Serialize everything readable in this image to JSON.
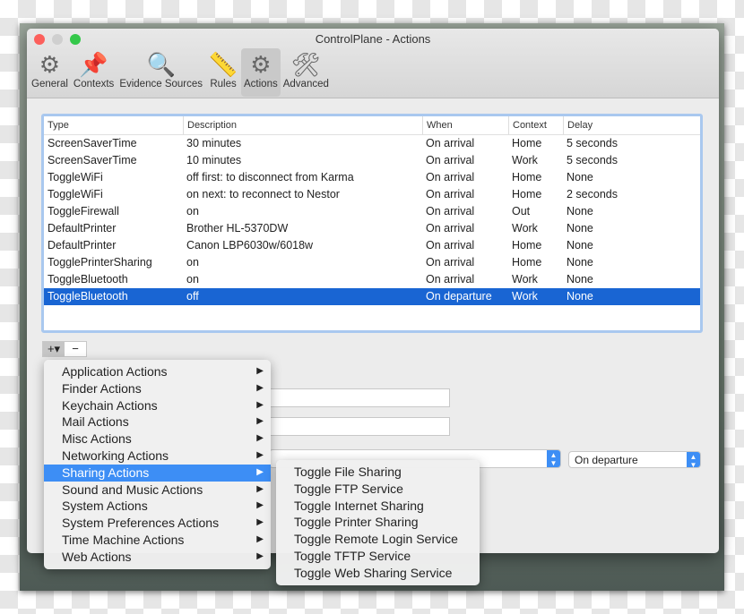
{
  "window": {
    "title": "ControlPlane - Actions"
  },
  "toolbar": [
    {
      "label": "General",
      "icon": "general-icon",
      "glyph": "⚙"
    },
    {
      "label": "Contexts",
      "icon": "pushpin-icon",
      "glyph": "📌"
    },
    {
      "label": "Evidence Sources",
      "icon": "magnifier-icon",
      "glyph": "🔍"
    },
    {
      "label": "Rules",
      "icon": "ruler-icon",
      "glyph": "📏"
    },
    {
      "label": "Actions",
      "icon": "gear-icon",
      "glyph": "⚙",
      "selected": true
    },
    {
      "label": "Advanced",
      "icon": "tools-icon",
      "glyph": "🛠"
    }
  ],
  "table": {
    "columns": [
      "Type",
      "Description",
      "When",
      "Context",
      "Delay"
    ],
    "rows": [
      [
        "ScreenSaverTime",
        "30 minutes",
        "On arrival",
        "Home",
        "5 seconds"
      ],
      [
        "ScreenSaverTime",
        "10 minutes",
        "On arrival",
        "Work",
        "5 seconds"
      ],
      [
        "ToggleWiFi",
        "off first: to disconnect from Karma",
        "On arrival",
        "Home",
        "None"
      ],
      [
        "ToggleWiFi",
        "on next: to reconnect to Nestor",
        "On arrival",
        "Home",
        "2 seconds"
      ],
      [
        "ToggleFirewall",
        "on",
        "On arrival",
        "Out",
        "None"
      ],
      [
        "DefaultPrinter",
        "Brother HL-5370DW",
        "On arrival",
        "Work",
        "None"
      ],
      [
        "DefaultPrinter",
        "Canon LBP6030w/6018w",
        "On arrival",
        "Home",
        "None"
      ],
      [
        "TogglePrinterSharing",
        "on",
        "On arrival",
        "Home",
        "None"
      ],
      [
        "ToggleBluetooth",
        "on",
        "On arrival",
        "Work",
        "None"
      ],
      [
        "ToggleBluetooth",
        "off",
        "On departure",
        "Work",
        "None"
      ]
    ],
    "selected_row": 9
  },
  "buttons": {
    "add": "+▾",
    "remove": "−"
  },
  "when_popup": {
    "value": "On departure"
  },
  "menu": {
    "items": [
      "Application Actions",
      "Finder Actions",
      "Keychain Actions",
      "Mail Actions",
      "Misc Actions",
      "Networking Actions",
      "Sharing Actions",
      "Sound and Music Actions",
      "System Actions",
      "System Preferences Actions",
      "Time Machine Actions",
      "Web Actions"
    ],
    "highlighted": 6,
    "submenu": [
      "Toggle File Sharing",
      "Toggle FTP Service",
      "Toggle Internet Sharing",
      "Toggle Printer Sharing",
      "Toggle Remote Login Service",
      "Toggle TFTP Service",
      "Toggle Web Sharing Service"
    ]
  },
  "colors": {
    "selection": "#1965d3",
    "menu_highlight": "#3d8ef5",
    "focus_ring": "#a9c8ef"
  }
}
